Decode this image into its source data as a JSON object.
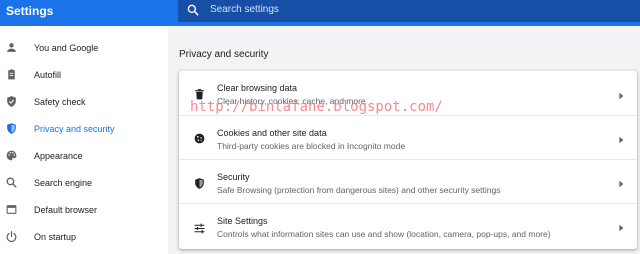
{
  "header": {
    "title": "Settings",
    "search_placeholder": "Search settings"
  },
  "sidebar": {
    "items": [
      {
        "label": "You and Google",
        "icon": "person-icon"
      },
      {
        "label": "Autofill",
        "icon": "clipboard-icon"
      },
      {
        "label": "Safety check",
        "icon": "shield-check-icon"
      },
      {
        "label": "Privacy and security",
        "icon": "shield-icon",
        "active": true
      },
      {
        "label": "Appearance",
        "icon": "palette-icon"
      },
      {
        "label": "Search engine",
        "icon": "search-icon"
      },
      {
        "label": "Default browser",
        "icon": "browser-icon"
      },
      {
        "label": "On startup",
        "icon": "power-icon"
      }
    ]
  },
  "main": {
    "section_title": "Privacy and security",
    "rows": [
      {
        "title": "Clear browsing data",
        "subtitle": "Clear history, cookies, cache, and more",
        "icon": "trash-icon"
      },
      {
        "title": "Cookies and other site data",
        "subtitle": "Third-party cookies are blocked in Incognito mode",
        "icon": "cookie-icon"
      },
      {
        "title": "Security",
        "subtitle": "Safe Browsing (protection from dangerous sites) and other security settings",
        "icon": "shield-icon"
      },
      {
        "title": "Site Settings",
        "subtitle": "Controls what information sites can use and show (location, camera, pop-ups, and more)",
        "icon": "tune-icon"
      }
    ]
  },
  "watermark": "http://bintafane.blogspot.com/",
  "colors": {
    "accent": "#1a73e8",
    "search_bar": "#174ea6",
    "background": "#f1f3f4"
  }
}
